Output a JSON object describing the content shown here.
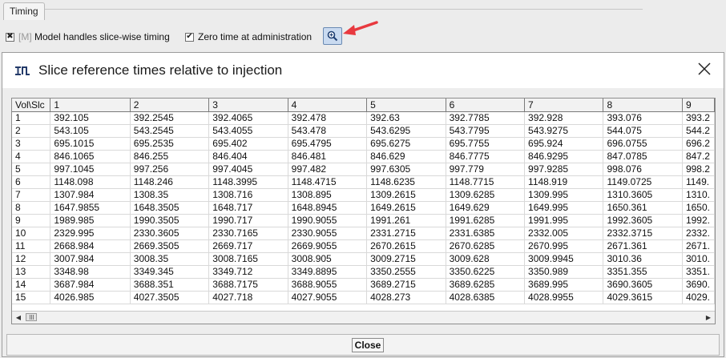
{
  "background": {
    "tab_label": "Timing",
    "option1": {
      "prefix": "[M]",
      "label": "Model handles slice-wise timing",
      "checked": true
    },
    "option2": {
      "label": "Zero time at administration",
      "checked": true
    },
    "zoom_button_icon": "zoom-in-icon"
  },
  "dialog": {
    "title": "Slice reference times relative to injection",
    "close_label": "Close",
    "table": {
      "headers": [
        "Vol\\Slc",
        "1",
        "2",
        "3",
        "4",
        "5",
        "6",
        "7",
        "8",
        "9"
      ],
      "rows": [
        [
          "1",
          "392.105",
          "392.2545",
          "392.4065",
          "392.478",
          "392.63",
          "392.7785",
          "392.928",
          "393.076",
          "393.2"
        ],
        [
          "2",
          "543.105",
          "543.2545",
          "543.4055",
          "543.478",
          "543.6295",
          "543.7795",
          "543.9275",
          "544.075",
          "544.2"
        ],
        [
          "3",
          "695.1015",
          "695.2535",
          "695.402",
          "695.4795",
          "695.6275",
          "695.7755",
          "695.924",
          "696.0755",
          "696.2"
        ],
        [
          "4",
          "846.1065",
          "846.255",
          "846.404",
          "846.481",
          "846.629",
          "846.7775",
          "846.9295",
          "847.0785",
          "847.2"
        ],
        [
          "5",
          "997.1045",
          "997.256",
          "997.4045",
          "997.482",
          "997.6305",
          "997.779",
          "997.9285",
          "998.076",
          "998.2"
        ],
        [
          "6",
          "1148.098",
          "1148.246",
          "1148.3995",
          "1148.4715",
          "1148.6235",
          "1148.7715",
          "1148.919",
          "1149.0725",
          "1149."
        ],
        [
          "7",
          "1307.984",
          "1308.35",
          "1308.716",
          "1308.895",
          "1309.2615",
          "1309.6285",
          "1309.995",
          "1310.3605",
          "1310."
        ],
        [
          "8",
          "1647.9855",
          "1648.3505",
          "1648.717",
          "1648.8945",
          "1649.2615",
          "1649.629",
          "1649.995",
          "1650.361",
          "1650."
        ],
        [
          "9",
          "1989.985",
          "1990.3505",
          "1990.717",
          "1990.9055",
          "1991.261",
          "1991.6285",
          "1991.995",
          "1992.3605",
          "1992."
        ],
        [
          "10",
          "2329.995",
          "2330.3605",
          "2330.7165",
          "2330.9055",
          "2331.2715",
          "2331.6385",
          "2332.005",
          "2332.3715",
          "2332."
        ],
        [
          "11",
          "2668.984",
          "2669.3505",
          "2669.717",
          "2669.9055",
          "2670.2615",
          "2670.6285",
          "2670.995",
          "2671.361",
          "2671."
        ],
        [
          "12",
          "3007.984",
          "3008.35",
          "3008.7165",
          "3008.905",
          "3009.2715",
          "3009.628",
          "3009.9945",
          "3010.36",
          "3010."
        ],
        [
          "13",
          "3348.98",
          "3349.345",
          "3349.712",
          "3349.8895",
          "3350.2555",
          "3350.6225",
          "3350.989",
          "3351.355",
          "3351."
        ],
        [
          "14",
          "3687.984",
          "3688.351",
          "3688.7175",
          "3688.9055",
          "3689.2715",
          "3689.6285",
          "3689.995",
          "3690.3605",
          "3690."
        ],
        [
          "15",
          "4026.985",
          "4027.3505",
          "4027.718",
          "4027.9055",
          "4028.273",
          "4028.6385",
          "4028.9955",
          "4029.3615",
          "4029."
        ]
      ]
    }
  },
  "colors": {
    "annotation_arrow": "#e8393f",
    "selected_button": "#c9daf0"
  }
}
